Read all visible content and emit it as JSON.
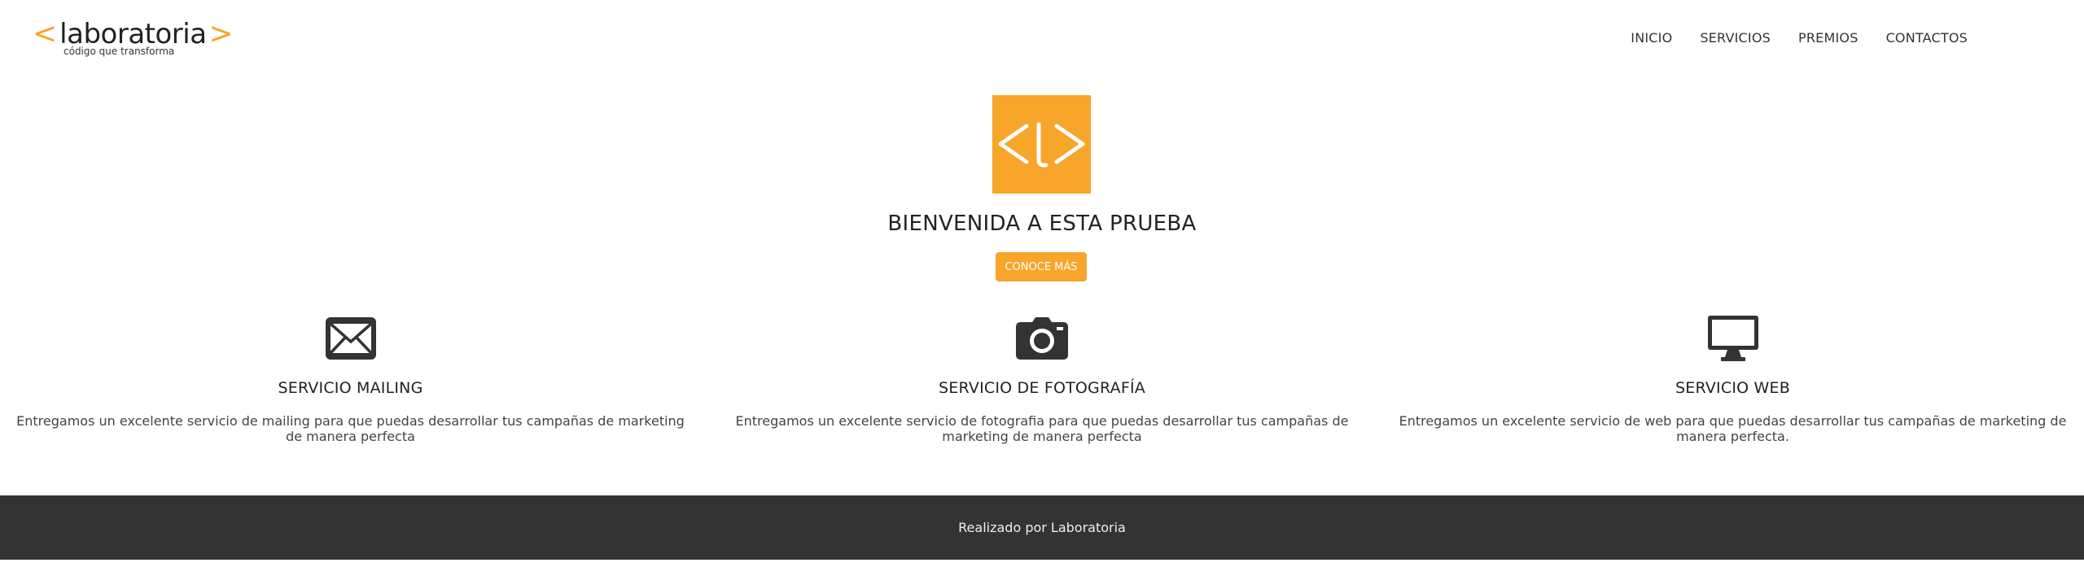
{
  "brand": {
    "bracket_open": "<",
    "name": "laboratoria",
    "bracket_close": ">",
    "tagline": "código que transforma",
    "accent_color": "#f7a52b"
  },
  "nav": {
    "items": [
      {
        "label": "INICIO"
      },
      {
        "label": "SERVICIOS"
      },
      {
        "label": "PREMIOS"
      },
      {
        "label": "CONTACTOS"
      }
    ]
  },
  "hero": {
    "logo_icon": "code-brackets-logo-icon",
    "title": "BIENVENIDA A ESTA PRUEBA",
    "cta_label": "CONOCE MÁS"
  },
  "services": [
    {
      "icon": "envelope-icon",
      "title": "SERVICIO MAILING",
      "description": "Entregamos un excelente servicio de mailing para que puedas desarrollar tus campañas de marketing de manera perfecta"
    },
    {
      "icon": "camera-icon",
      "title": "SERVICIO DE FOTOGRAFÍA",
      "description": "Entregamos un excelente servicio de fotografia para que puedas desarrollar tus campañas de marketing de manera perfecta"
    },
    {
      "icon": "monitor-icon",
      "title": "SERVICIO WEB",
      "description": "Entregamos un excelente servicio de web para que puedas desarrollar tus campañas de marketing de manera perfecta."
    }
  ],
  "footer": {
    "text": "Realizado por Laboratoria",
    "background": "#333333"
  }
}
